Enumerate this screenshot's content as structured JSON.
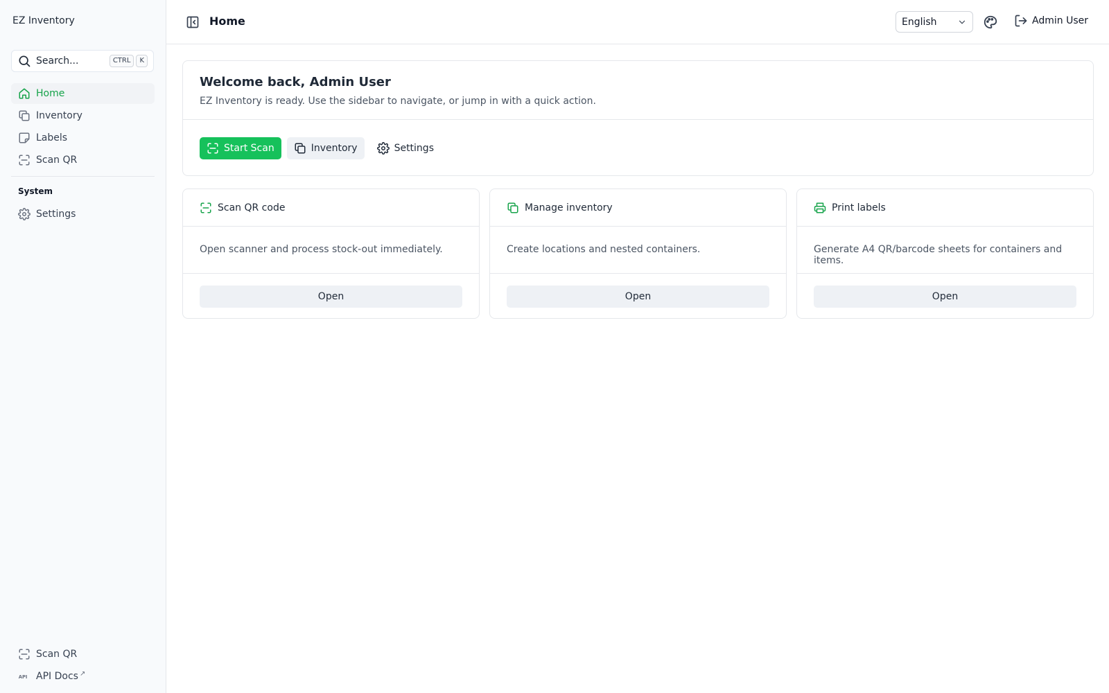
{
  "app": {
    "name": "EZ Inventory"
  },
  "search": {
    "placeholder": "Search...",
    "kbd": [
      "CTRL",
      "K"
    ]
  },
  "sidebar": {
    "items": [
      {
        "label": "Home",
        "icon": "home-icon",
        "active": true
      },
      {
        "label": "Inventory",
        "icon": "copy-icon"
      },
      {
        "label": "Labels",
        "icon": "sticky-note-icon"
      },
      {
        "label": "Scan QR",
        "icon": "scan-icon"
      }
    ],
    "section_label": "System",
    "system_items": [
      {
        "label": "Settings",
        "icon": "gear-icon"
      }
    ],
    "bottom_items": [
      {
        "label": "Scan QR",
        "icon": "scan-icon"
      },
      {
        "label": "API Docs",
        "icon": "api-icon",
        "external_mark": "↗"
      }
    ]
  },
  "header": {
    "title": "Home",
    "language": "English",
    "user": "Admin User"
  },
  "welcome": {
    "title": "Welcome back, Admin User",
    "subtitle": "EZ Inventory is ready. Use the sidebar to navigate, or jump in with a quick action.",
    "actions": {
      "start_scan": "Start Scan",
      "inventory": "Inventory",
      "settings": "Settings"
    }
  },
  "cards": [
    {
      "title": "Scan QR code",
      "description": "Open scanner and process stock-out immediately.",
      "button": "Open",
      "icon": "scan-icon"
    },
    {
      "title": "Manage inventory",
      "description": "Create locations and nested containers.",
      "button": "Open",
      "icon": "copy-icon"
    },
    {
      "title": "Print labels",
      "description": "Generate A4 QR/barcode sheets for containers and items.",
      "button": "Open",
      "icon": "printer-icon"
    }
  ],
  "colors": {
    "accent": "#16c15b",
    "accent_text": "#16a34a",
    "muted": "#6b7280",
    "border": "#e5e7eb"
  }
}
